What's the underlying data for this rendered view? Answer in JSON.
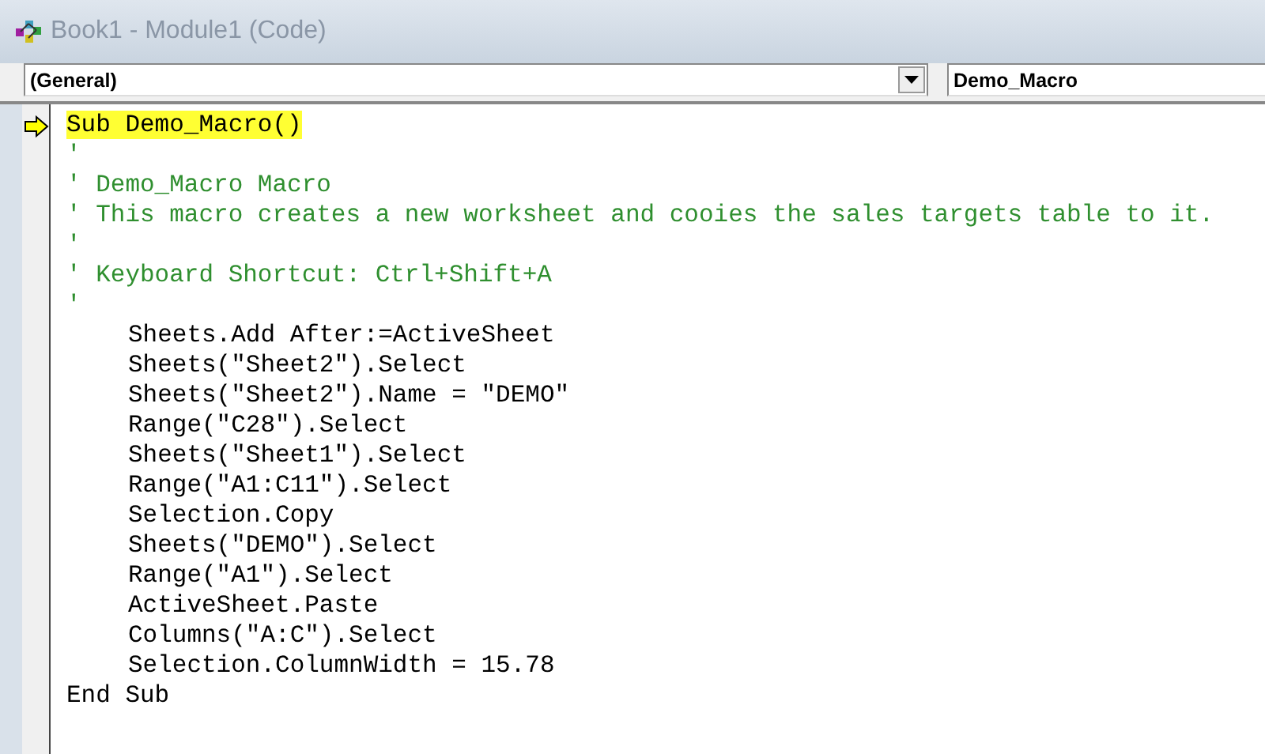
{
  "window": {
    "title": "Book1 - Module1 (Code)"
  },
  "object_dropdown": {
    "value": "(General)"
  },
  "procedure_dropdown": {
    "value": "Demo_Macro"
  },
  "code": {
    "lines": [
      {
        "kind": "line",
        "text": "Sub Demo_Macro()",
        "current": true
      },
      {
        "kind": "comment",
        "text": "'",
        "current": false
      },
      {
        "kind": "comment",
        "text": "' Demo_Macro Macro",
        "current": false
      },
      {
        "kind": "comment",
        "text": "' This macro creates a new worksheet and cooies the sales targets table to it.",
        "current": false
      },
      {
        "kind": "comment",
        "text": "'",
        "current": false
      },
      {
        "kind": "comment",
        "text": "' Keyboard Shortcut: Ctrl+Shift+A",
        "current": false
      },
      {
        "kind": "comment",
        "text": "'",
        "current": false
      },
      {
        "kind": "indented",
        "text": "Sheets.Add After:=ActiveSheet",
        "current": false
      },
      {
        "kind": "indented",
        "text": "Sheets(\"Sheet2\").Select",
        "current": false
      },
      {
        "kind": "indented",
        "text": "Sheets(\"Sheet2\").Name = \"DEMO\"",
        "current": false
      },
      {
        "kind": "indented",
        "text": "Range(\"C28\").Select",
        "current": false
      },
      {
        "kind": "indented",
        "text": "Sheets(\"Sheet1\").Select",
        "current": false
      },
      {
        "kind": "indented",
        "text": "Range(\"A1:C11\").Select",
        "current": false
      },
      {
        "kind": "indented",
        "text": "Selection.Copy",
        "current": false
      },
      {
        "kind": "indented",
        "text": "Sheets(\"DEMO\").Select",
        "current": false
      },
      {
        "kind": "indented",
        "text": "Range(\"A1\").Select",
        "current": false
      },
      {
        "kind": "indented",
        "text": "ActiveSheet.Paste",
        "current": false
      },
      {
        "kind": "indented",
        "text": "Columns(\"A:C\").Select",
        "current": false
      },
      {
        "kind": "indented",
        "text": "Selection.ColumnWidth = 15.78",
        "current": false
      },
      {
        "kind": "line",
        "text": "End Sub",
        "current": false
      }
    ]
  }
}
